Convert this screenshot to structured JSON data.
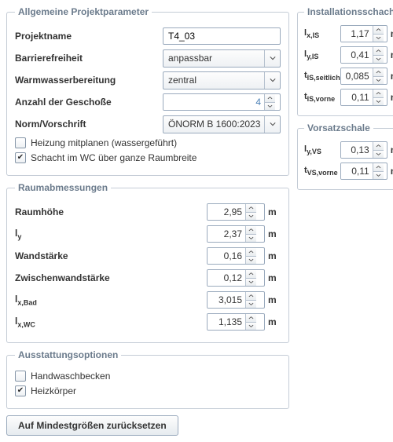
{
  "general": {
    "legend": "Allgemeine Projektparameter",
    "projektname_label": "Projektname",
    "projektname_value": "T4_03",
    "barriere_label": "Barrierefreiheit",
    "barriere_value": "anpassbar",
    "ww_label": "Warmwasserbereitung",
    "ww_value": "zentral",
    "geschosse_label": "Anzahl der Geschoße",
    "geschosse_value": "4",
    "norm_label": "Norm/Vorschrift",
    "norm_value": "ÖNORM B 1600:2023",
    "heizung_label": "Heizung mitplanen (wassergeführt)",
    "heizung_checked": false,
    "schacht_label": "Schacht im WC über ganze Raumbreite",
    "schacht_checked": true
  },
  "raum": {
    "legend": "Raumabmessungen",
    "rows": [
      {
        "label_html": "Raumhöhe",
        "value": "2,95",
        "unit": "m"
      },
      {
        "label_html": "l<sub>y</sub>",
        "value": "2,37",
        "unit": "m"
      },
      {
        "label_html": "Wandstärke",
        "value": "0,16",
        "unit": "m"
      },
      {
        "label_html": "Zwischenwandstärke",
        "value": "0,12",
        "unit": "m"
      },
      {
        "label_html": "l<sub>x,Bad</sub>",
        "value": "3,015",
        "unit": "m"
      },
      {
        "label_html": "l<sub>x,WC</sub>",
        "value": "1,135",
        "unit": "m"
      }
    ]
  },
  "ausstattung": {
    "legend": "Ausstattungsoptionen",
    "handwasch_label": "Handwaschbecken",
    "handwasch_checked": false,
    "heizkoerper_label": "Heizkörper",
    "heizkoerper_checked": true
  },
  "reset_button": "Auf Mindestgrößen zurücksetzen",
  "install": {
    "legend": "Installationsschacht",
    "rows": [
      {
        "label_html": "l<sub>x,IS</sub>",
        "value": "1,17",
        "unit": "m"
      },
      {
        "label_html": "l<sub>y,IS</sub>",
        "value": "0,41",
        "unit": "m"
      },
      {
        "label_html": "t<sub>IS,seitlich</sub>",
        "value": "0,085",
        "unit": "m"
      },
      {
        "label_html": "t<sub>IS,vorne</sub>",
        "value": "0,11",
        "unit": "m"
      }
    ]
  },
  "vorsatz": {
    "legend": "Vorsatzschale",
    "rows": [
      {
        "label_html": "l<sub>y,VS</sub>",
        "value": "0,13",
        "unit": "m"
      },
      {
        "label_html": "t<sub>VS,vorne</sub>",
        "value": "0,11",
        "unit": "m"
      }
    ]
  }
}
